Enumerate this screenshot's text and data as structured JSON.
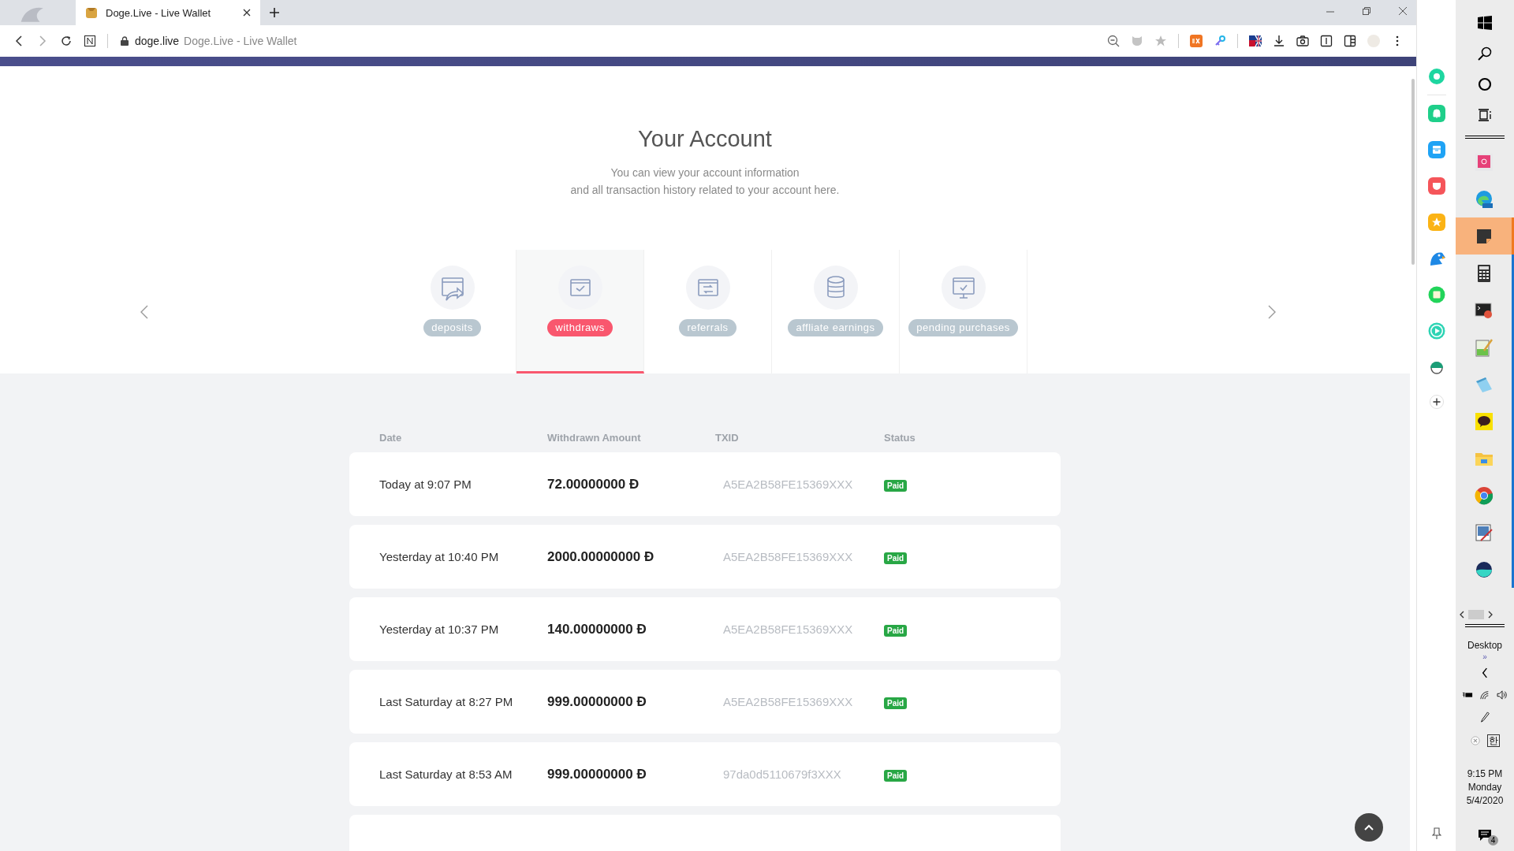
{
  "browser": {
    "tab_title": "Doge.Live - Live Wallet",
    "address_domain": "doge.live",
    "address_title": "Doge.Live - Live Wallet"
  },
  "page": {
    "title": "Your Account",
    "subtitle_lines": [
      "You can view your account information",
      "and all transaction history related to your account here."
    ]
  },
  "categories": [
    {
      "label": "deposits",
      "kind": "send",
      "selected": false
    },
    {
      "label": "withdraws",
      "kind": "check",
      "selected": true
    },
    {
      "label": "referrals",
      "kind": "swap",
      "selected": false
    },
    {
      "label": "affliate earnings",
      "kind": "database",
      "selected": false
    },
    {
      "label": "pending purchases",
      "kind": "monitor",
      "selected": false
    }
  ],
  "table": {
    "columns": [
      "Date",
      "Withdrawn Amount",
      "TXID",
      "Status"
    ],
    "rows": [
      {
        "date": "Today at 9:07 PM",
        "amount": "72.00000000 Đ",
        "txid": "A5EA2B58FE15369XXX",
        "status": "Paid"
      },
      {
        "date": "Yesterday at 10:40 PM",
        "amount": "2000.00000000 Đ",
        "txid": "A5EA2B58FE15369XXX",
        "status": "Paid"
      },
      {
        "date": "Yesterday at 10:37 PM",
        "amount": "140.00000000 Đ",
        "txid": "A5EA2B58FE15369XXX",
        "status": "Paid"
      },
      {
        "date": "Last Saturday at 8:27 PM",
        "amount": "999.00000000 Đ",
        "txid": "A5EA2B58FE15369XXX",
        "status": "Paid"
      },
      {
        "date": "Last Saturday at 8:53 AM",
        "amount": "999.00000000 Đ",
        "txid": "97da0d5110679f3XXX",
        "status": "Paid"
      }
    ]
  },
  "sidebar": {
    "items": [
      {
        "kind": "ring",
        "color": "#1ed6a0"
      },
      {
        "kind": "bell",
        "color": "#1fcf8a"
      },
      {
        "kind": "box",
        "color": "#1fa3f5"
      },
      {
        "kind": "pocket",
        "color": "#f5555a"
      },
      {
        "kind": "star",
        "color": "#fbb315"
      },
      {
        "kind": "bird",
        "color": "#1e88e5"
      },
      {
        "kind": "square",
        "color": "#22d45a"
      },
      {
        "kind": "play",
        "color": "#2dd4b4"
      },
      {
        "kind": "face",
        "color": "#1b9e77"
      }
    ]
  },
  "taskbar": {
    "apps": [
      {
        "kind": "screen",
        "selected": false,
        "running": false
      },
      {
        "kind": "edge",
        "selected": false,
        "running": false
      },
      {
        "kind": "note",
        "selected": true,
        "running": true
      },
      {
        "kind": "calculator",
        "selected": false,
        "running": true
      },
      {
        "kind": "terminal",
        "selected": false,
        "running": true
      },
      {
        "kind": "editor",
        "selected": false,
        "running": true
      },
      {
        "kind": "notepad",
        "selected": false,
        "running": true
      },
      {
        "kind": "chat",
        "selected": false,
        "running": true
      },
      {
        "kind": "folder",
        "selected": false,
        "running": true
      },
      {
        "kind": "globe",
        "selected": false,
        "running": true
      },
      {
        "kind": "paint",
        "selected": false,
        "running": true
      },
      {
        "kind": "whale",
        "selected": false,
        "running": true
      }
    ],
    "desktop_label": "Desktop",
    "chevrons": "»",
    "ime": "한",
    "time": "9:15 PM",
    "day": "Monday",
    "date": "5/4/2020",
    "notifications": "4"
  }
}
